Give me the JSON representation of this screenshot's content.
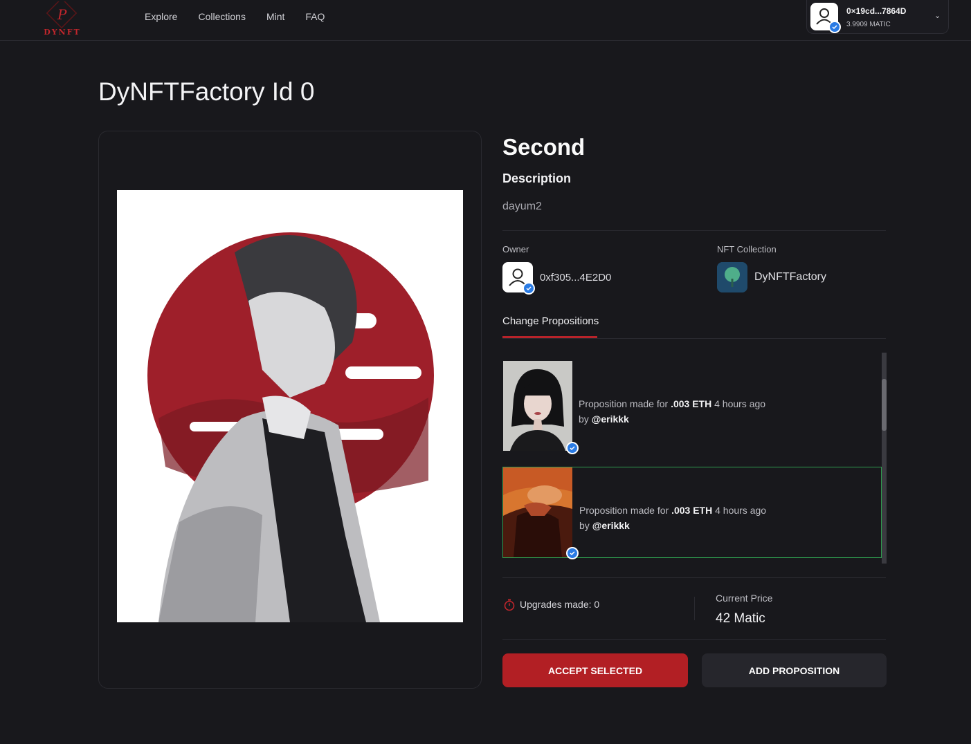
{
  "nav": {
    "logo_text": "DYNFT",
    "links": [
      "Explore",
      "Collections",
      "Mint",
      "FAQ"
    ],
    "wallet": {
      "address": "0×19cd...7864D",
      "balance": "3.9909 MATIC",
      "icon": "chevron-down-icon"
    }
  },
  "page_title": "DyNFTFactory Id 0",
  "nft": {
    "name": "Second",
    "description_heading": "Description",
    "description": "dayum2",
    "owner_label": "Owner",
    "owner": "0xf305...4E2D0",
    "collection_label": "NFT Collection",
    "collection": "DyNFTFactory"
  },
  "tabs": {
    "active": "Change Propositions"
  },
  "propositions": [
    {
      "prefix": "Proposition made for",
      "amount": ".003 ETH",
      "time": "4 hours ago",
      "by": "by",
      "user": "@erikkk",
      "selected": false
    },
    {
      "prefix": "Proposition made for",
      "amount": ".003 ETH",
      "time": "4 hours ago",
      "by": "by",
      "user": "@erikkk",
      "selected": true
    }
  ],
  "stats": {
    "upgrades": "Upgrades made: 0",
    "price_label": "Current Price",
    "price": "42 Matic"
  },
  "buttons": {
    "accept": "ACCEPT SELECTED",
    "add": "ADD PROPOSITION"
  },
  "colors": {
    "background": "#18181c",
    "accent": "#b21f24",
    "selected_border": "#2f9e4f",
    "verified": "#2a7be4"
  }
}
